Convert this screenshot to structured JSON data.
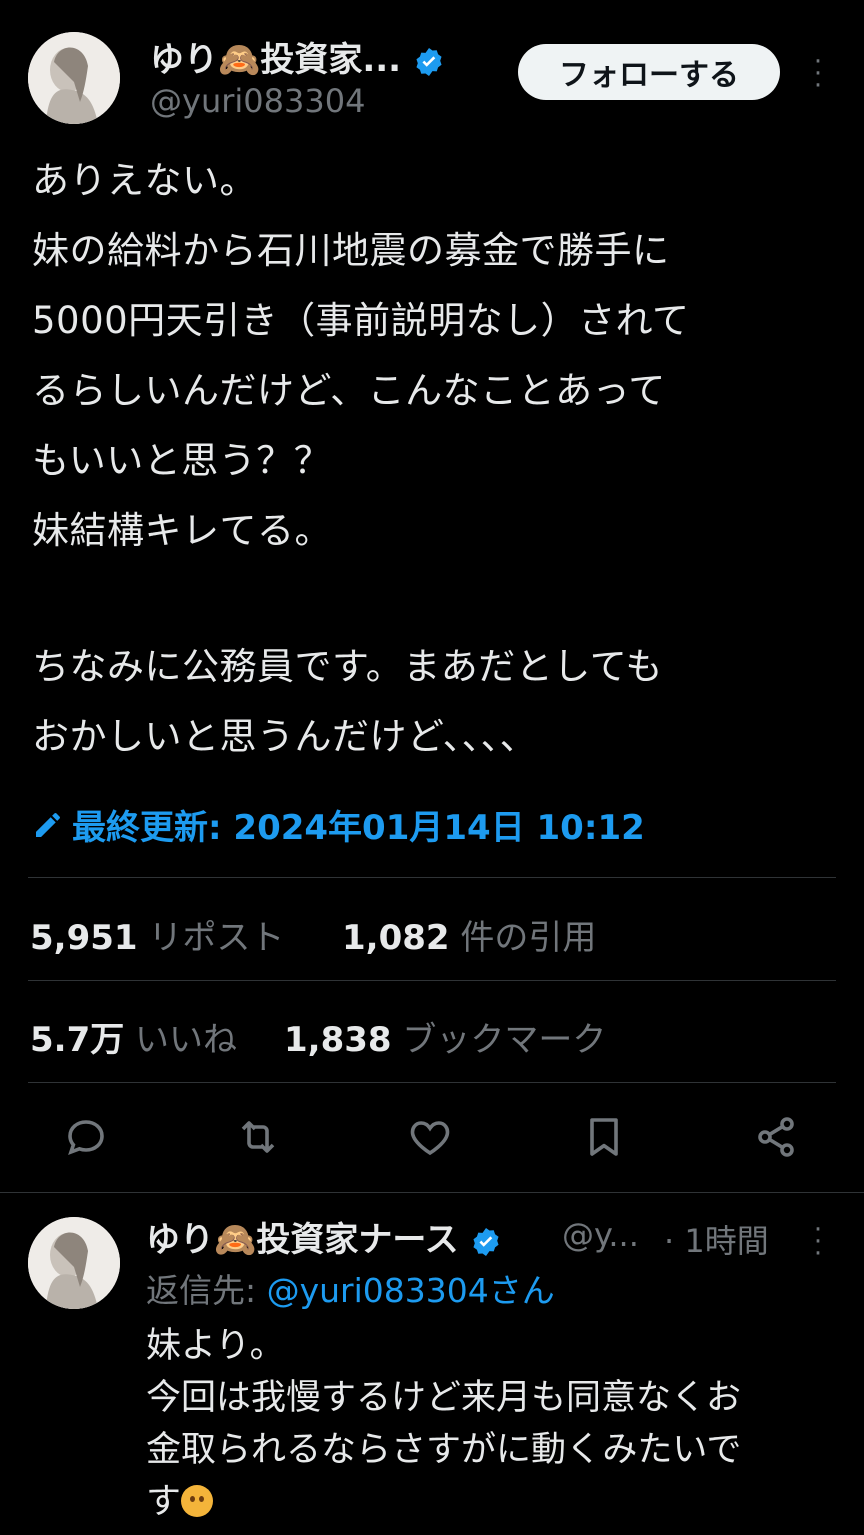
{
  "main_tweet": {
    "display_name": "ゆり🙈投資家...",
    "handle": "@yuri083304",
    "follow_label": "フォローする",
    "lines": [
      "ありえない。",
      "妹の給料から石川地震の募金で勝手に",
      "5000円天引き（事前説明なし）されて",
      "るらしいんだけど、こんなことあって",
      "もいいと思う？？",
      "妹結構キレてる。",
      "",
      "ちなみに公務員です。まあだとしても",
      "おかしいと思うんだけど、、、、"
    ],
    "edited_label": "最終更新: 2024年01月14日 10:12"
  },
  "stats": {
    "reposts_count": "5,951",
    "reposts_label": "リポスト",
    "quotes_count": "1,082",
    "quotes_label": "件の引用",
    "likes_count": "5.7万",
    "likes_label": "いいね",
    "bookmarks_count": "1,838",
    "bookmarks_label": "ブックマーク"
  },
  "actions": [
    "reply-icon",
    "repost-icon",
    "like-icon",
    "bookmark-icon",
    "share-icon"
  ],
  "reply": {
    "display_name": "ゆり🙈投資家ナース",
    "handle": "@y...",
    "time": "· 1時間",
    "replying_prefix": "返信先: ",
    "replying_to": "@yuri083304さん",
    "lines": [
      "妹より。",
      "今回は我慢するけど来月も同意なくお",
      "金取られるならさすがに動くみたいで",
      "す"
    ]
  },
  "colors": {
    "background": "#000000",
    "text": "#e7e9ea",
    "secondary": "#71767b",
    "accent": "#1d9bf0",
    "divider": "#2f3336"
  }
}
